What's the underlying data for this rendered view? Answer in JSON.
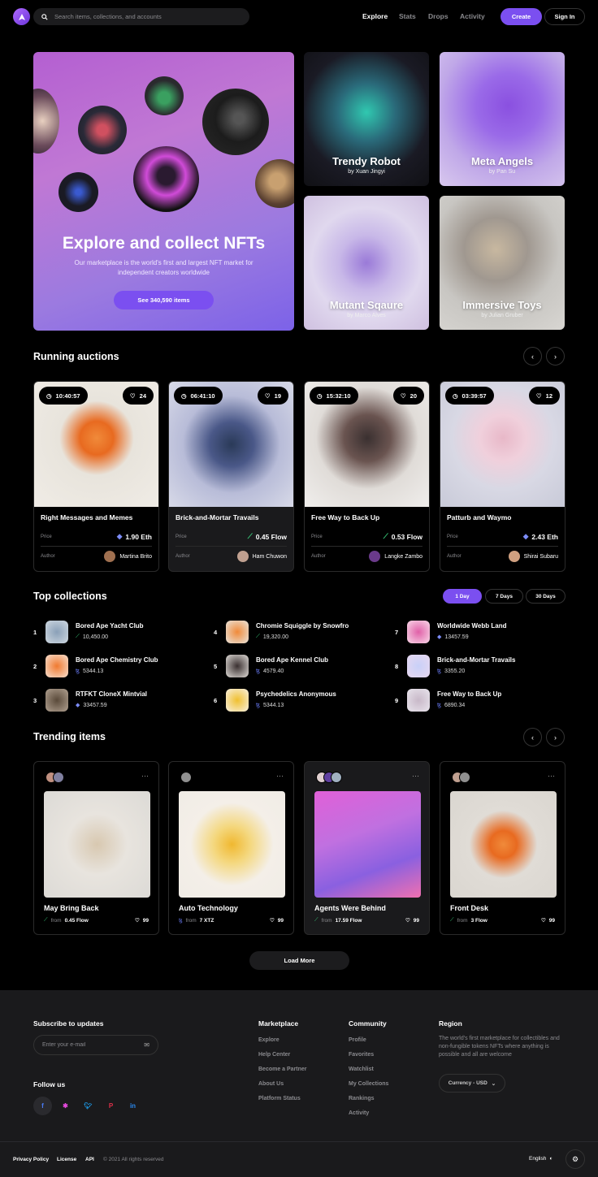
{
  "header": {
    "search_placeholder": "Search items, collections, and accounts",
    "nav": [
      "Explore",
      "Stats",
      "Drops",
      "Activity"
    ],
    "create": "Create",
    "sign_in": "Sign In"
  },
  "hero": {
    "title": "Explore and collect NFTs",
    "subtitle": "Our marketplace is the world's first and largest NFT market for independent creators worldwide",
    "button": "See 340,590 items"
  },
  "featured": [
    {
      "title": "Trendy Robot",
      "author": "by Xuan Jingyi"
    },
    {
      "title": "Meta Angels",
      "author": "by Pan Su"
    },
    {
      "title": "Mutant Sqaure",
      "author": "by Marco Alves"
    },
    {
      "title": "Immersive Toys",
      "author": "by Julian Gruber"
    }
  ],
  "auctions": {
    "title": "Running auctions",
    "price_label": "Price",
    "author_label": "Author",
    "items": [
      {
        "timer": "10:40:57",
        "likes": "24",
        "name": "Right Messages and Memes",
        "price": "1.90 Eth",
        "author": "Martina Brito"
      },
      {
        "timer": "06:41:10",
        "likes": "19",
        "name": "Brick-and-Mortar Travails",
        "price": "0.45 Flow",
        "author": "Ham Chuwon"
      },
      {
        "timer": "15:32:10",
        "likes": "20",
        "name": "Free Way to Back Up",
        "price": "0.53 Flow",
        "author": "Langke Zambo"
      },
      {
        "timer": "03:39:57",
        "likes": "12",
        "name": "Patturb and Waymo",
        "price": "2.43 Eth",
        "author": "Shirai Subaru"
      }
    ]
  },
  "collections": {
    "title": "Top collections",
    "tabs": [
      "1 Day",
      "7 Days",
      "30 Days"
    ],
    "items": [
      {
        "rank": "1",
        "name": "Bored Ape Yacht Club",
        "value": "10,450.00"
      },
      {
        "rank": "2",
        "name": "Bored Ape Chemistry Club",
        "value": "5344.13"
      },
      {
        "rank": "3",
        "name": "RTFKT CloneX Mintvial",
        "value": "33457.59"
      },
      {
        "rank": "4",
        "name": "Chromie Squiggle by Snowfro",
        "value": "19,320.00"
      },
      {
        "rank": "5",
        "name": "Bored Ape Kennel Club",
        "value": "4579.40"
      },
      {
        "rank": "6",
        "name": "Psychedelics Anonymous",
        "value": "5344.13"
      },
      {
        "rank": "7",
        "name": "Worldwide Webb Land",
        "value": "13457.59"
      },
      {
        "rank": "8",
        "name": "Brick-and-Mortar Travails",
        "value": "3355.20"
      },
      {
        "rank": "9",
        "name": "Free Way to Back Up",
        "value": "6890.34"
      }
    ]
  },
  "trending": {
    "title": "Trending items",
    "from": "from",
    "items": [
      {
        "name": "May Bring Back",
        "price": "0.45 Flow",
        "likes": "99"
      },
      {
        "name": "Auto Technology",
        "price": "7 XTZ",
        "likes": "99"
      },
      {
        "name": "Agents Were Behind",
        "price": "17.59 Flow",
        "likes": "99"
      },
      {
        "name": "Front Desk",
        "price": "3 Flow",
        "likes": "99"
      }
    ],
    "load_more": "Load More"
  },
  "footer": {
    "subscribe": "Subscribe to updates",
    "email_placeholder": "Enter your e-mail",
    "follow": "Follow us",
    "marketplace": {
      "title": "Marketplace",
      "links": [
        "Explore",
        "Help Center",
        "Become a Partner",
        "About Us",
        "Platform Status"
      ]
    },
    "community": {
      "title": "Community",
      "links": [
        "Profile",
        "Favorites",
        "Watchlist",
        "My Collections",
        "Rankings",
        "Activity"
      ]
    },
    "region": {
      "title": "Region",
      "text": "The world's first marketplace for collectibles and non-fungible tokens NFTs where anything is possible and all are welcome",
      "currency": "Currency - USD"
    },
    "bottom": [
      "Privacy Policy",
      "License",
      "API",
      "© 2021 All rights reserved"
    ],
    "language": "English"
  },
  "colors": {
    "accent": "#7b4ff0",
    "background": "#000000",
    "footer": "#1a1a1c"
  }
}
